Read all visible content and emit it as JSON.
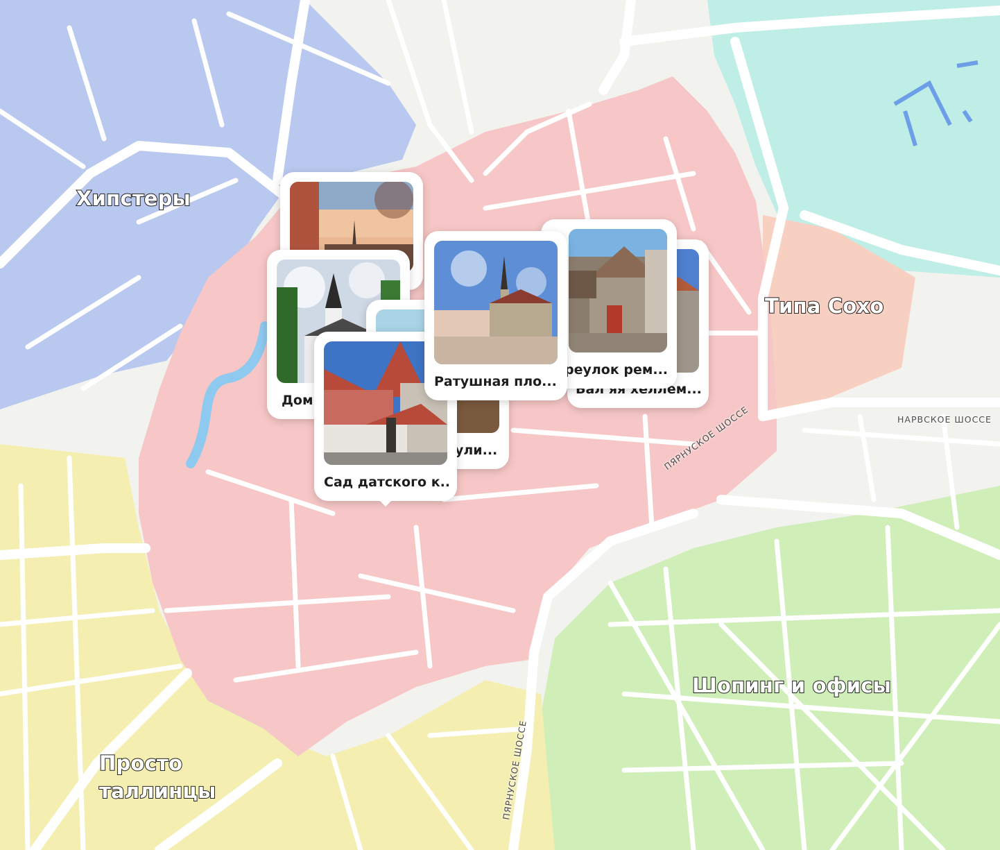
{
  "map": {
    "colors": {
      "hipsters": "#b9c8ee",
      "old_town": "#f6c7c6",
      "soho": "#f8d0c2",
      "harbour": "#bfeee6",
      "shopping": "#cfeeb8",
      "locals": "#f4efb0",
      "background": "#f2f3ef",
      "road": "#ffffff",
      "water": "#8ec9ef"
    },
    "districts": [
      {
        "id": "hipsters",
        "label": "Хипстеры"
      },
      {
        "id": "soho",
        "label": "Типа Сохо"
      },
      {
        "id": "shopping",
        "label": "Шопинг и офисы"
      },
      {
        "id": "locals",
        "label": "Просто таллинцы"
      }
    ],
    "roads": {
      "narva": "НАРВСКОЕ ШОССЕ",
      "parnu_east": "ПЯРНУСКОЕ ШОССЕ",
      "parnu_south": "ПЯРНУСКОЕ ШОССЕ"
    }
  },
  "places": [
    {
      "id": "tower",
      "title": "",
      "photo": "tower-view-photo"
    },
    {
      "id": "dome",
      "title": "Дом",
      "photo": "dome-church-photo"
    },
    {
      "id": "street",
      "title": "ули...",
      "photo": "street-photo"
    },
    {
      "id": "garden",
      "title": "Сад датского к...",
      "photo": "danish-garden-photo"
    },
    {
      "id": "square",
      "title": "Ратушная пло...",
      "photo": "town-hall-square-photo"
    },
    {
      "id": "lane_back",
      "title": "Бал яя хеллем...",
      "photo": "tower-wall-photo"
    },
    {
      "id": "lane",
      "title": "реулок рем...",
      "photo": "craftsmen-lane-photo"
    }
  ]
}
